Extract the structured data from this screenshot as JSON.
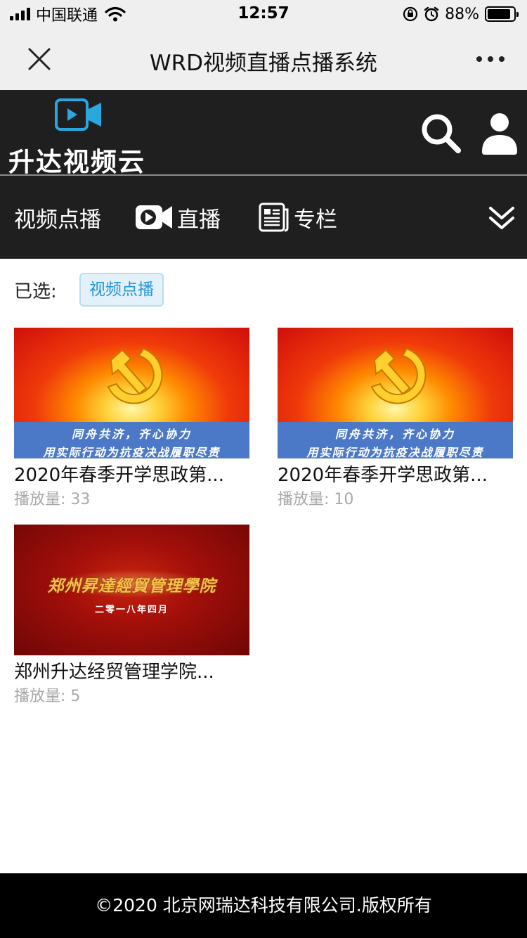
{
  "status_bar": {
    "carrier": "中国联通",
    "time": "12:57",
    "battery_percent": "88%",
    "battery_level": 0.88,
    "icons": [
      "signal-icon",
      "wifi-icon",
      "orientation-lock-icon",
      "alarm-icon",
      "battery-icon"
    ]
  },
  "nav": {
    "title": "WRD视频直播点播系统",
    "close_icon": "close-icon",
    "more_icon": "more-icon"
  },
  "header": {
    "logo_text": "升达视频云",
    "logo_icon": "video-camera-icon",
    "search_icon": "search-icon",
    "user_icon": "user-icon",
    "accent_color": "#29a8e0"
  },
  "categories": {
    "vod": "视频点播",
    "live": "直播",
    "column": "专栏",
    "expand_icon": "double-chevron-down-icon"
  },
  "filter": {
    "label": "已选:",
    "tag": "视频点播"
  },
  "videos": [
    {
      "title": "2020年春季开学思政第...",
      "views": "播放量: 33",
      "thumb_line1": "同舟共济，齐心协力",
      "thumb_line2": "用实际行动为抗疫决战履职尽责"
    },
    {
      "title": "2020年春季开学思政第...",
      "views": "播放量: 10",
      "thumb_line1": "同舟共济，齐心协力",
      "thumb_line2": "用实际行动为抗疫决战履职尽责"
    },
    {
      "title": "郑州升达经贸管理学院...",
      "views": "播放量: 5",
      "thumb_line1": "郑州昇達經貿管理學院",
      "thumb_line2": "二零一八年四月"
    }
  ],
  "footer": {
    "copyright": "©2020 北京网瑞达科技有限公司.版权所有"
  }
}
